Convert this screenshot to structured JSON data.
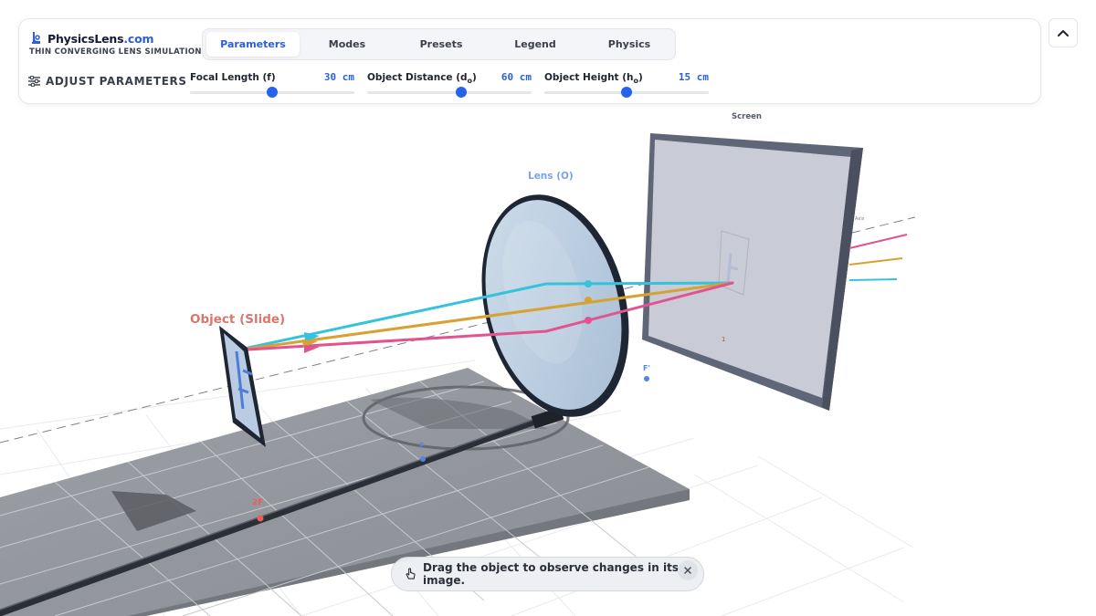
{
  "brand": {
    "name_main": "PhysicsLens",
    "name_tld": ".com",
    "subtitle": "THIN CONVERGING LENS SIMULATION",
    "logo_icon": "flask-icon"
  },
  "tabs": [
    {
      "label": "Parameters",
      "active": true
    },
    {
      "label": "Modes",
      "active": false
    },
    {
      "label": "Presets",
      "active": false
    },
    {
      "label": "Legend",
      "active": false
    },
    {
      "label": "Physics",
      "active": false
    }
  ],
  "adjust": {
    "label": "ADJUST PARAMETERS",
    "icon": "sliders-icon"
  },
  "sliders": [
    {
      "label": "Focal Length (f)",
      "label_main": "Focal Length (f)",
      "label_sub": "",
      "label_tail": "",
      "value": "30 cm",
      "fraction": 0.5
    },
    {
      "label": "Object Distance (do)",
      "label_main": "Object Distance (d",
      "label_sub": "o",
      "label_tail": ")",
      "value": "60 cm",
      "fraction": 0.57
    },
    {
      "label": "Object Height (ho)",
      "label_main": "Object Height (h",
      "label_sub": "o",
      "label_tail": ")",
      "value": "15 cm",
      "fraction": 0.5
    }
  ],
  "scene": {
    "object_label": "Object (Slide)",
    "lens_label": "Lens (O)",
    "screen_label": "Screen",
    "f_prime_label": "F'",
    "f_label": "F",
    "two_f_label": "2F",
    "axis_label": "Axis",
    "image_marker": "1"
  },
  "colors": {
    "accent": "#2c5fd6",
    "ray_cyan": "#34c3dc",
    "ray_gold": "#d8a233",
    "ray_pink": "#e2538f",
    "object_label": "#d9776e",
    "two_f": "#ef5b5b"
  },
  "toast": {
    "text": "Drag the object to observe changes in its image.",
    "icon": "hand-pointer-icon",
    "close_icon": "close-icon"
  },
  "collapse_icon": "chevron-up-icon"
}
